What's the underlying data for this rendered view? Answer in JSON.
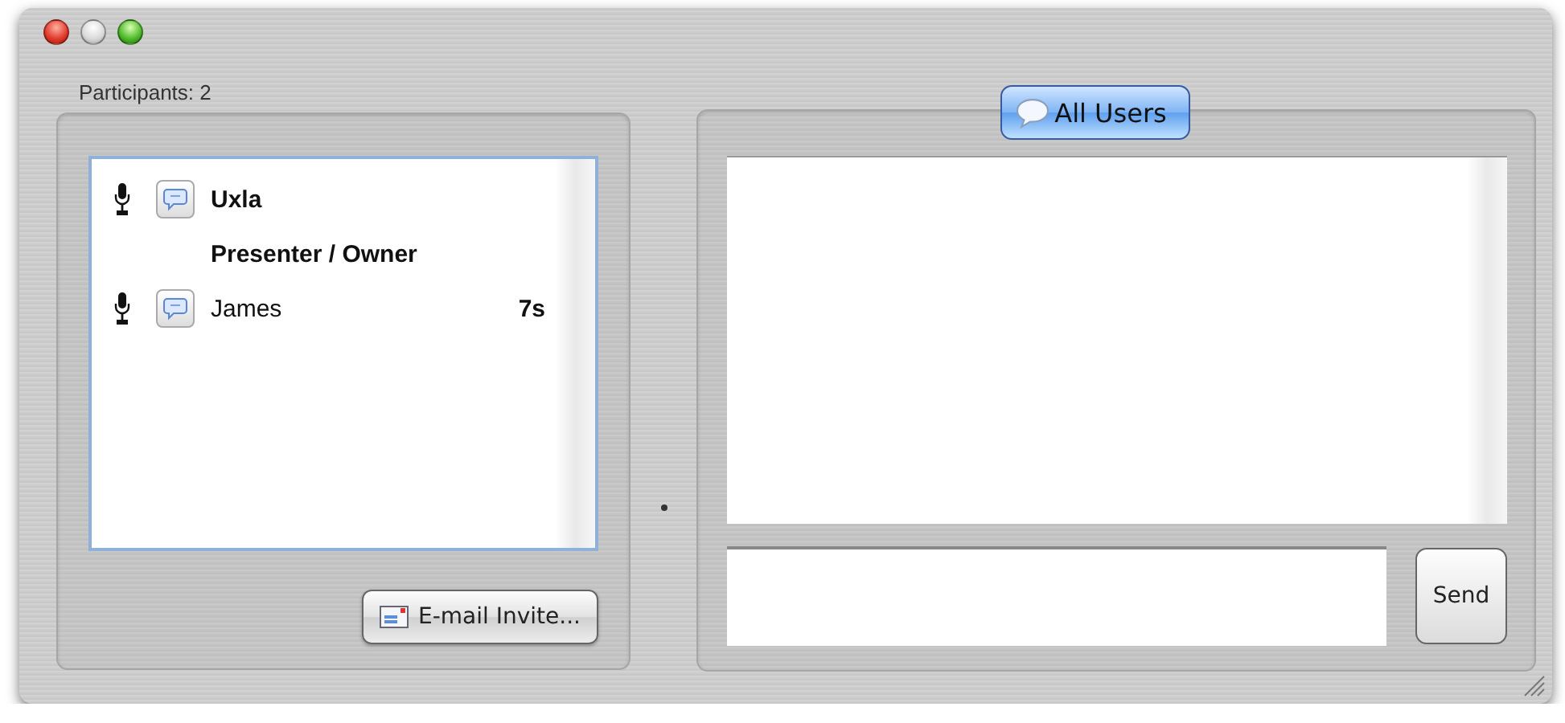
{
  "participants_label": "Participants: 2",
  "participants": [
    {
      "name": "Uxla",
      "presenter": true,
      "role": "Presenter / Owner"
    },
    {
      "name": "James",
      "presenter": false,
      "time": "7s"
    }
  ],
  "invite_button": "E-mail Invite...",
  "chat_tab": {
    "label": "All Users",
    "selected": true
  },
  "send_button": "Send"
}
